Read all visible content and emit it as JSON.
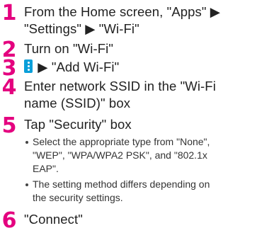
{
  "steps": [
    {
      "num": "1",
      "lines": [
        "From the Home screen, \"Apps\" ▶",
        "\"Settings\" ▶ \"Wi-Fi\""
      ]
    },
    {
      "num": "2",
      "lines": [
        "Turn on \"Wi-Fi\""
      ]
    },
    {
      "num": "3",
      "icon": "menu-dots-icon",
      "text": "▶ \"Add Wi-Fi\""
    },
    {
      "num": "4",
      "lines": [
        "Enter network SSID in the \"Wi-Fi",
        "name (SSID)\" box"
      ]
    },
    {
      "num": "5",
      "lines": [
        "Tap \"Security\" box"
      ],
      "bullets": [
        [
          "Select the appropriate type from \"None\",",
          "\"WEP\", \"WPA/WPA2 PSK\", and \"802.1x",
          "EAP\"."
        ],
        [
          "The setting method differs depending on",
          "the security settings."
        ]
      ]
    },
    {
      "num": "6",
      "lines": [
        "\"Connect\""
      ]
    }
  ],
  "colors": {
    "step_number": "#e4007f",
    "menu_icon": "#0a9fd9"
  }
}
